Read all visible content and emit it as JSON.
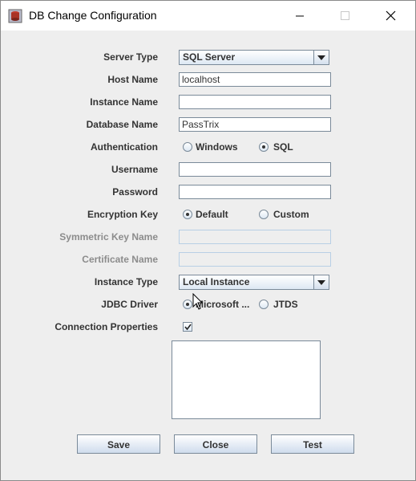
{
  "window": {
    "title": "DB Change Configuration",
    "icon": "db-app-icon",
    "controls": [
      "minimize-icon",
      "maximize-icon",
      "close-icon"
    ]
  },
  "form": {
    "server_type": {
      "label": "Server Type",
      "value": "SQL Server"
    },
    "host_name": {
      "label": "Host Name",
      "value": "localhost"
    },
    "instance_name": {
      "label": "Instance Name",
      "value": ""
    },
    "database_name": {
      "label": "Database Name",
      "value": "PassTrix"
    },
    "authentication": {
      "label": "Authentication",
      "options": [
        "Windows",
        "SQL"
      ],
      "selected": "SQL"
    },
    "username": {
      "label": "Username",
      "value": ""
    },
    "password": {
      "label": "Password",
      "value": ""
    },
    "encryption_key": {
      "label": "Encryption Key",
      "options": [
        "Default",
        "Custom"
      ],
      "selected": "Default"
    },
    "symmetric_key_name": {
      "label": "Symmetric Key Name",
      "value": "",
      "enabled": false
    },
    "certificate_name": {
      "label": "Certificate Name",
      "value": "",
      "enabled": false
    },
    "instance_type": {
      "label": "Instance Type",
      "value": "Local Instance"
    },
    "jdbc_driver": {
      "label": "JDBC Driver",
      "options": [
        "Microsoft ...",
        "JTDS"
      ],
      "selected": "Microsoft ..."
    },
    "connection_properties": {
      "label": "Connection Properties",
      "checked": true,
      "value": ""
    }
  },
  "buttons": {
    "save": "Save",
    "close": "Close",
    "test": "Test"
  }
}
